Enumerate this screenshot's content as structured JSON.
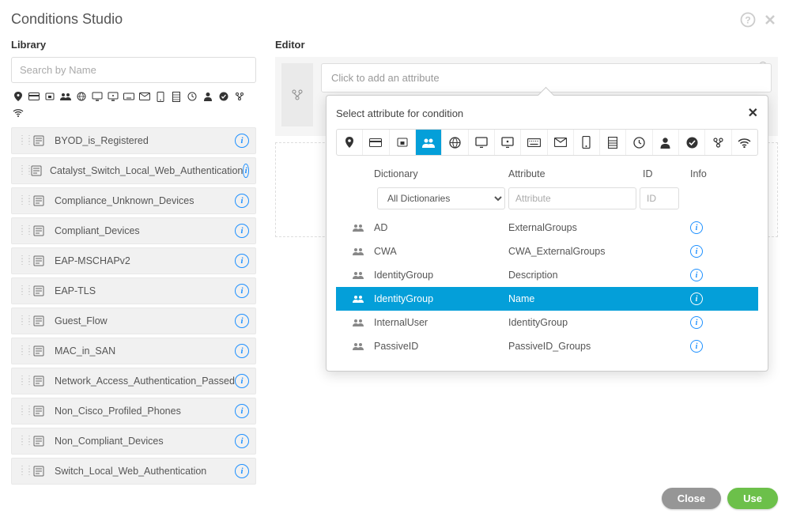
{
  "header": {
    "title": "Conditions Studio"
  },
  "library": {
    "title": "Library",
    "search_placeholder": "Search by Name",
    "items": [
      {
        "name": "BYOD_is_Registered"
      },
      {
        "name": "Catalyst_Switch_Local_Web_Authentication"
      },
      {
        "name": "Compliance_Unknown_Devices"
      },
      {
        "name": "Compliant_Devices"
      },
      {
        "name": "EAP-MSCHAPv2"
      },
      {
        "name": "EAP-TLS"
      },
      {
        "name": "Guest_Flow"
      },
      {
        "name": "MAC_in_SAN"
      },
      {
        "name": "Network_Access_Authentication_Passed"
      },
      {
        "name": "Non_Cisco_Profiled_Phones"
      },
      {
        "name": "Non_Compliant_Devices"
      },
      {
        "name": "Switch_Local_Web_Authentication"
      }
    ]
  },
  "editor": {
    "title": "Editor",
    "attr_placeholder": "Click to add an attribute"
  },
  "popup": {
    "title": "Select attribute for condition",
    "cols": {
      "dict": "Dictionary",
      "attr": "Attribute",
      "id": "ID",
      "info": "Info"
    },
    "dict_filter_label": "All Dictionaries",
    "attr_filter_placeholder": "Attribute",
    "id_filter_placeholder": "ID",
    "rows": [
      {
        "dict": "AD",
        "attr": "ExternalGroups"
      },
      {
        "dict": "CWA",
        "attr": "CWA_ExternalGroups"
      },
      {
        "dict": "IdentityGroup",
        "attr": "Description"
      },
      {
        "dict": "IdentityGroup",
        "attr": "Name",
        "selected": true
      },
      {
        "dict": "InternalUser",
        "attr": "IdentityGroup"
      },
      {
        "dict": "PassiveID",
        "attr": "PassiveID_Groups"
      }
    ]
  },
  "footer": {
    "close": "Close",
    "use": "Use"
  }
}
